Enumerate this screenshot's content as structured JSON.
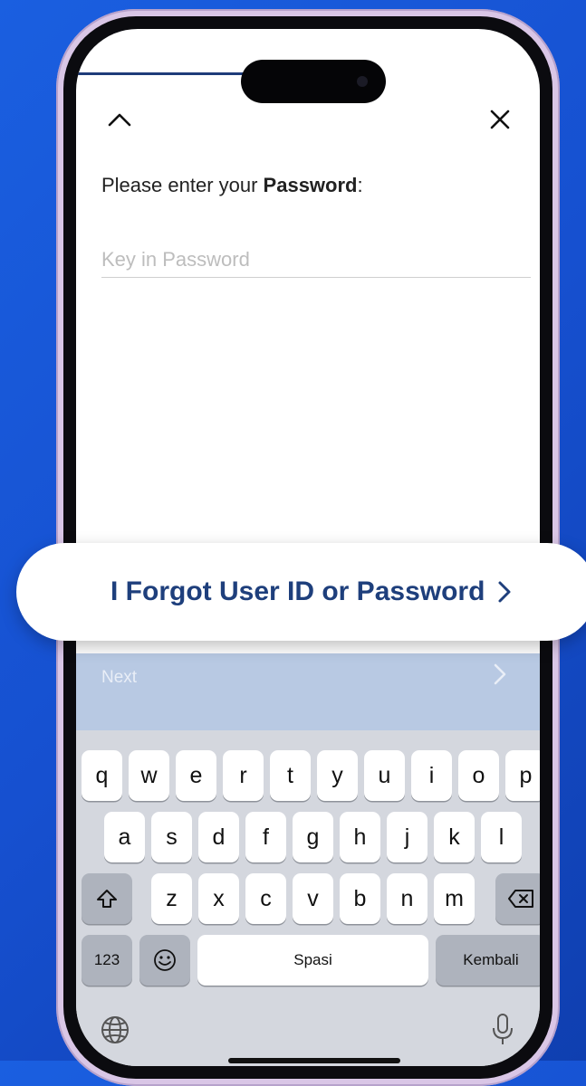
{
  "login": {
    "prompt_prefix": "Please enter your ",
    "prompt_bold": "Password",
    "prompt_suffix": ":",
    "password_placeholder": "Key in Password",
    "password_value": ""
  },
  "forgot": {
    "label": "I Forgot User ID or Password"
  },
  "toolbar": {
    "next_label": "Next"
  },
  "keyboard": {
    "row1": [
      "q",
      "w",
      "e",
      "r",
      "t",
      "y",
      "u",
      "i",
      "o",
      "p"
    ],
    "row2": [
      "a",
      "s",
      "d",
      "f",
      "g",
      "h",
      "j",
      "k",
      "l"
    ],
    "row3": [
      "z",
      "x",
      "c",
      "v",
      "b",
      "n",
      "m"
    ],
    "numbers_label": "123",
    "space_label": "Spasi",
    "return_label": "Kembali"
  },
  "icons": [
    "chevron-up-icon",
    "close-icon",
    "chevron-right-icon",
    "shift-icon",
    "backspace-icon",
    "emoji-icon",
    "globe-icon",
    "microphone-icon"
  ],
  "colors": {
    "background": "#1a5fe0",
    "brand_text": "#1e3f7c",
    "next_bar": "#b8c9e3",
    "keyboard": "#d4d7de"
  }
}
